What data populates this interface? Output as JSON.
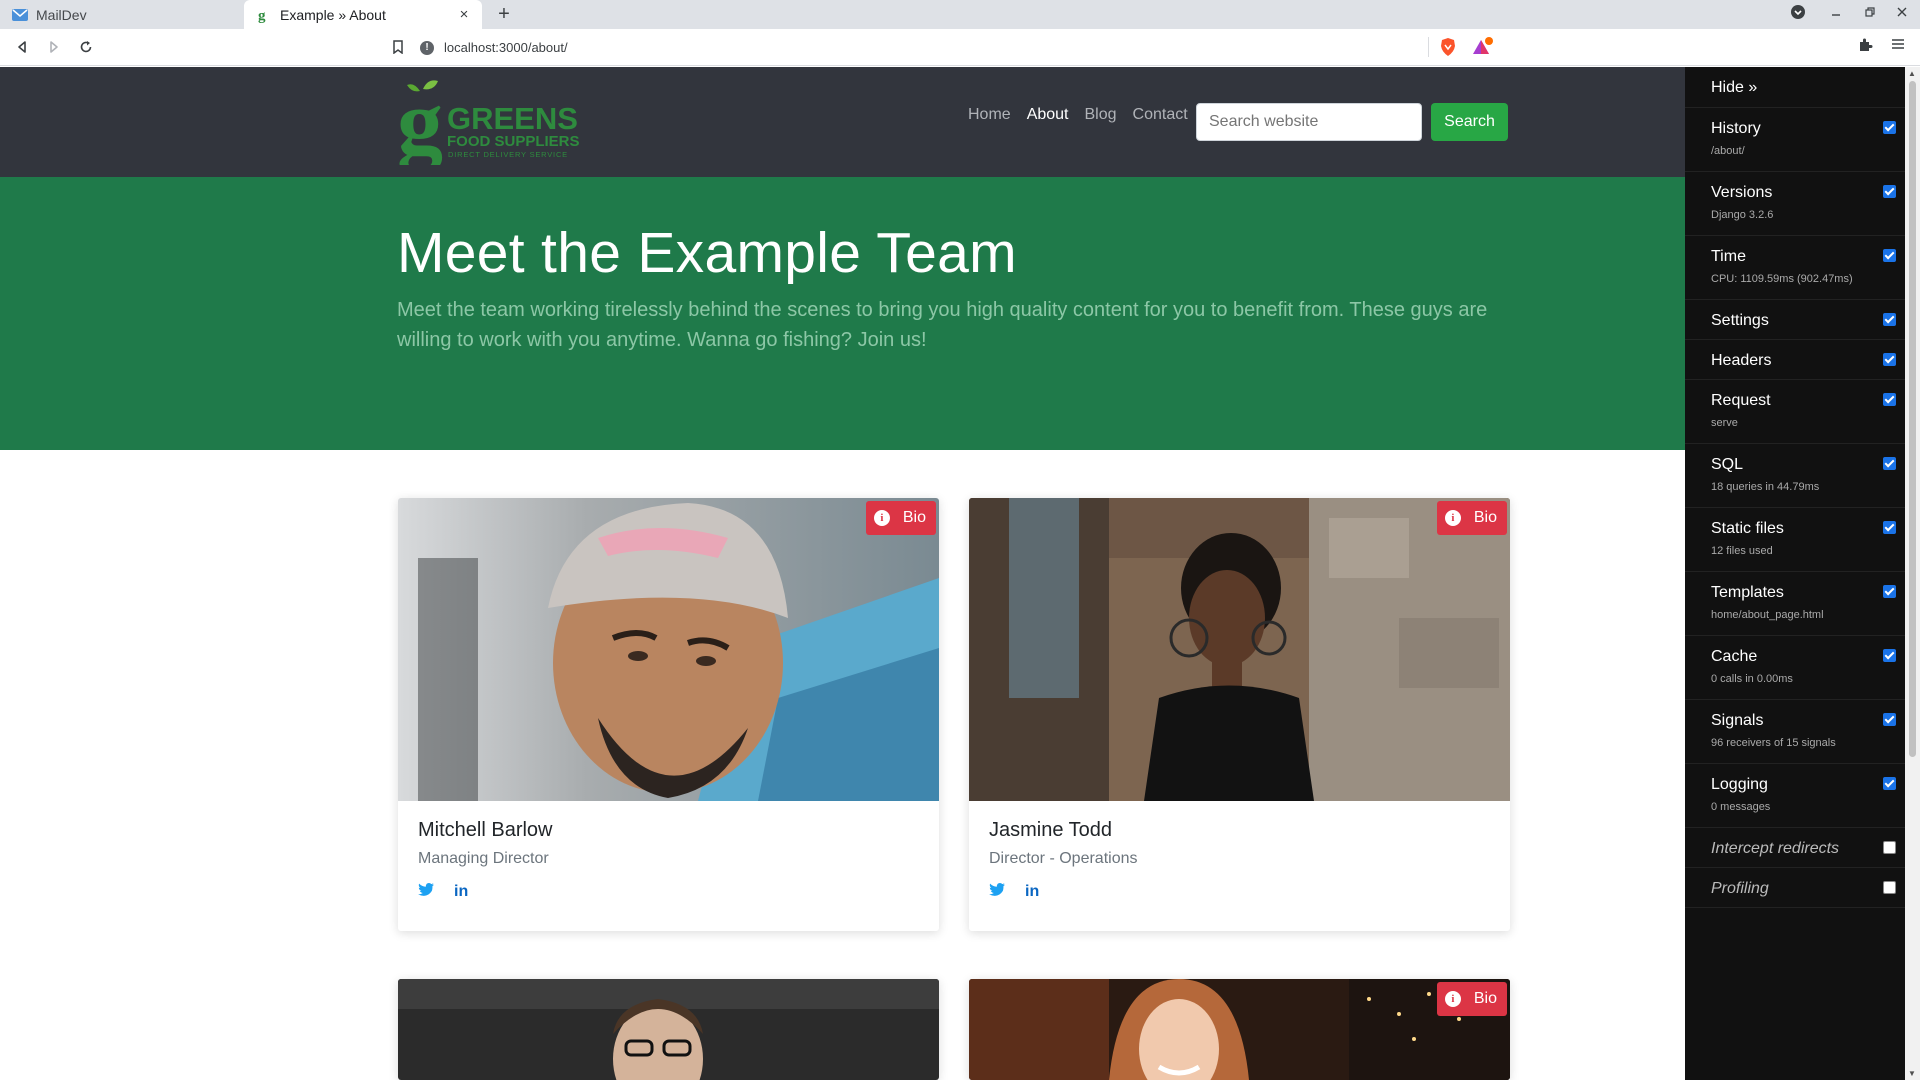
{
  "browser": {
    "tabs": [
      {
        "label": "MailDev",
        "icon": "mail-icon",
        "active": false
      },
      {
        "label": "Example » About",
        "icon": "greens-favicon",
        "active": true
      }
    ],
    "close_tab": "×",
    "new_tab": "+",
    "url": "localhost:3000/about/"
  },
  "site": {
    "logo": {
      "line1": "GREENS",
      "line2": "FOOD SUPPLIERS",
      "line3": "DIRECT DELIVERY SERVICE"
    },
    "nav": [
      "Home",
      "About",
      "Blog",
      "Contact"
    ],
    "nav_active": "About",
    "search": {
      "placeholder": "Search website",
      "button": "Search"
    },
    "hero": {
      "title": "Meet the Example Team",
      "subtitle": "Meet the team working tirelessly behind the scenes to bring you high quality content for you to benefit from. These guys are willing to work with you anytime. Wanna go fishing? Join us!"
    },
    "team": [
      {
        "name": "Mitchell Barlow",
        "role": "Managing Director",
        "badge": "Bio"
      },
      {
        "name": "Jasmine Todd",
        "role": "Director - Operations",
        "badge": "Bio"
      },
      {
        "name": "",
        "role": "",
        "badge": ""
      },
      {
        "name": "",
        "role": "",
        "badge": "Bio"
      }
    ],
    "social": {
      "twitter": "twitter-icon",
      "linkedin": "linkedin-icon",
      "linkedin_glyph": "in"
    }
  },
  "debug_toolbar": {
    "hide": "Hide »",
    "panels": [
      {
        "title": "History",
        "sub": "/about/",
        "checked": true
      },
      {
        "title": "Versions",
        "sub": "Django 3.2.6",
        "checked": true
      },
      {
        "title": "Time",
        "sub": "CPU: 1109.59ms (902.47ms)",
        "checked": true
      },
      {
        "title": "Settings",
        "sub": "",
        "checked": true
      },
      {
        "title": "Headers",
        "sub": "",
        "checked": true
      },
      {
        "title": "Request",
        "sub": "serve",
        "checked": true
      },
      {
        "title": "SQL",
        "sub": "18 queries in 44.79ms",
        "checked": true
      },
      {
        "title": "Static files",
        "sub": "12 files used",
        "checked": true
      },
      {
        "title": "Templates",
        "sub": "home/about_page.html",
        "checked": true
      },
      {
        "title": "Cache",
        "sub": "0 calls in 0.00ms",
        "checked": true
      },
      {
        "title": "Signals",
        "sub": "96 receivers of 15 signals",
        "checked": true
      },
      {
        "title": "Logging",
        "sub": "0 messages",
        "checked": true
      },
      {
        "title": "Intercept redirects",
        "sub": "",
        "checked": false
      },
      {
        "title": "Profiling",
        "sub": "",
        "checked": false
      }
    ]
  },
  "colors": {
    "header_bg": "#32353d",
    "hero_bg": "#1f7a4a",
    "accent_green": "#28a745",
    "badge_red": "#dc3545",
    "toolbar_bg": "#111111"
  }
}
